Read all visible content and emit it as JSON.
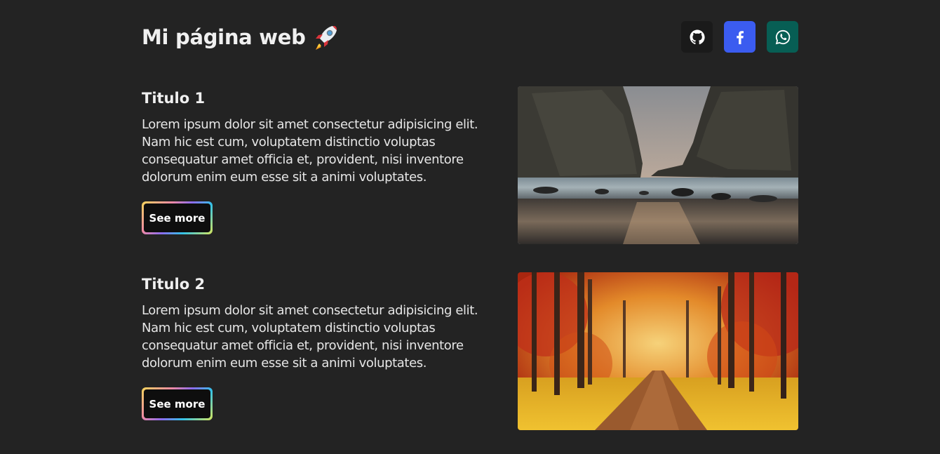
{
  "header": {
    "title": "Mi página web",
    "title_icon": "rocket-emoji"
  },
  "social": [
    {
      "name": "github",
      "icon": "github-icon",
      "color": "#1a1a1a"
    },
    {
      "name": "facebook",
      "icon": "facebook-icon",
      "color": "#3b5cf0"
    },
    {
      "name": "whatsapp",
      "icon": "whatsapp-icon",
      "color": "#075e54"
    }
  ],
  "cards": [
    {
      "title": "Titulo 1",
      "body": "Lorem ipsum dolor sit amet consectetur adipisicing elit. Nam hic est cum, voluptatem distinctio voluptas consequatur amet officia et, provident, nisi inventore dolorum enim eum esse sit a animi voluptates.",
      "button": "See more",
      "image": "rocky-sea-coast-photo"
    },
    {
      "title": "Titulo 2",
      "body": "Lorem ipsum dolor sit amet consectetur adipisicing elit. Nam hic est cum, voluptatem distinctio voluptas consequatur amet officia et, provident, nisi inventore dolorum enim eum esse sit a animi voluptates.",
      "button": "See more",
      "image": "autumn-forest-path-photo"
    }
  ]
}
